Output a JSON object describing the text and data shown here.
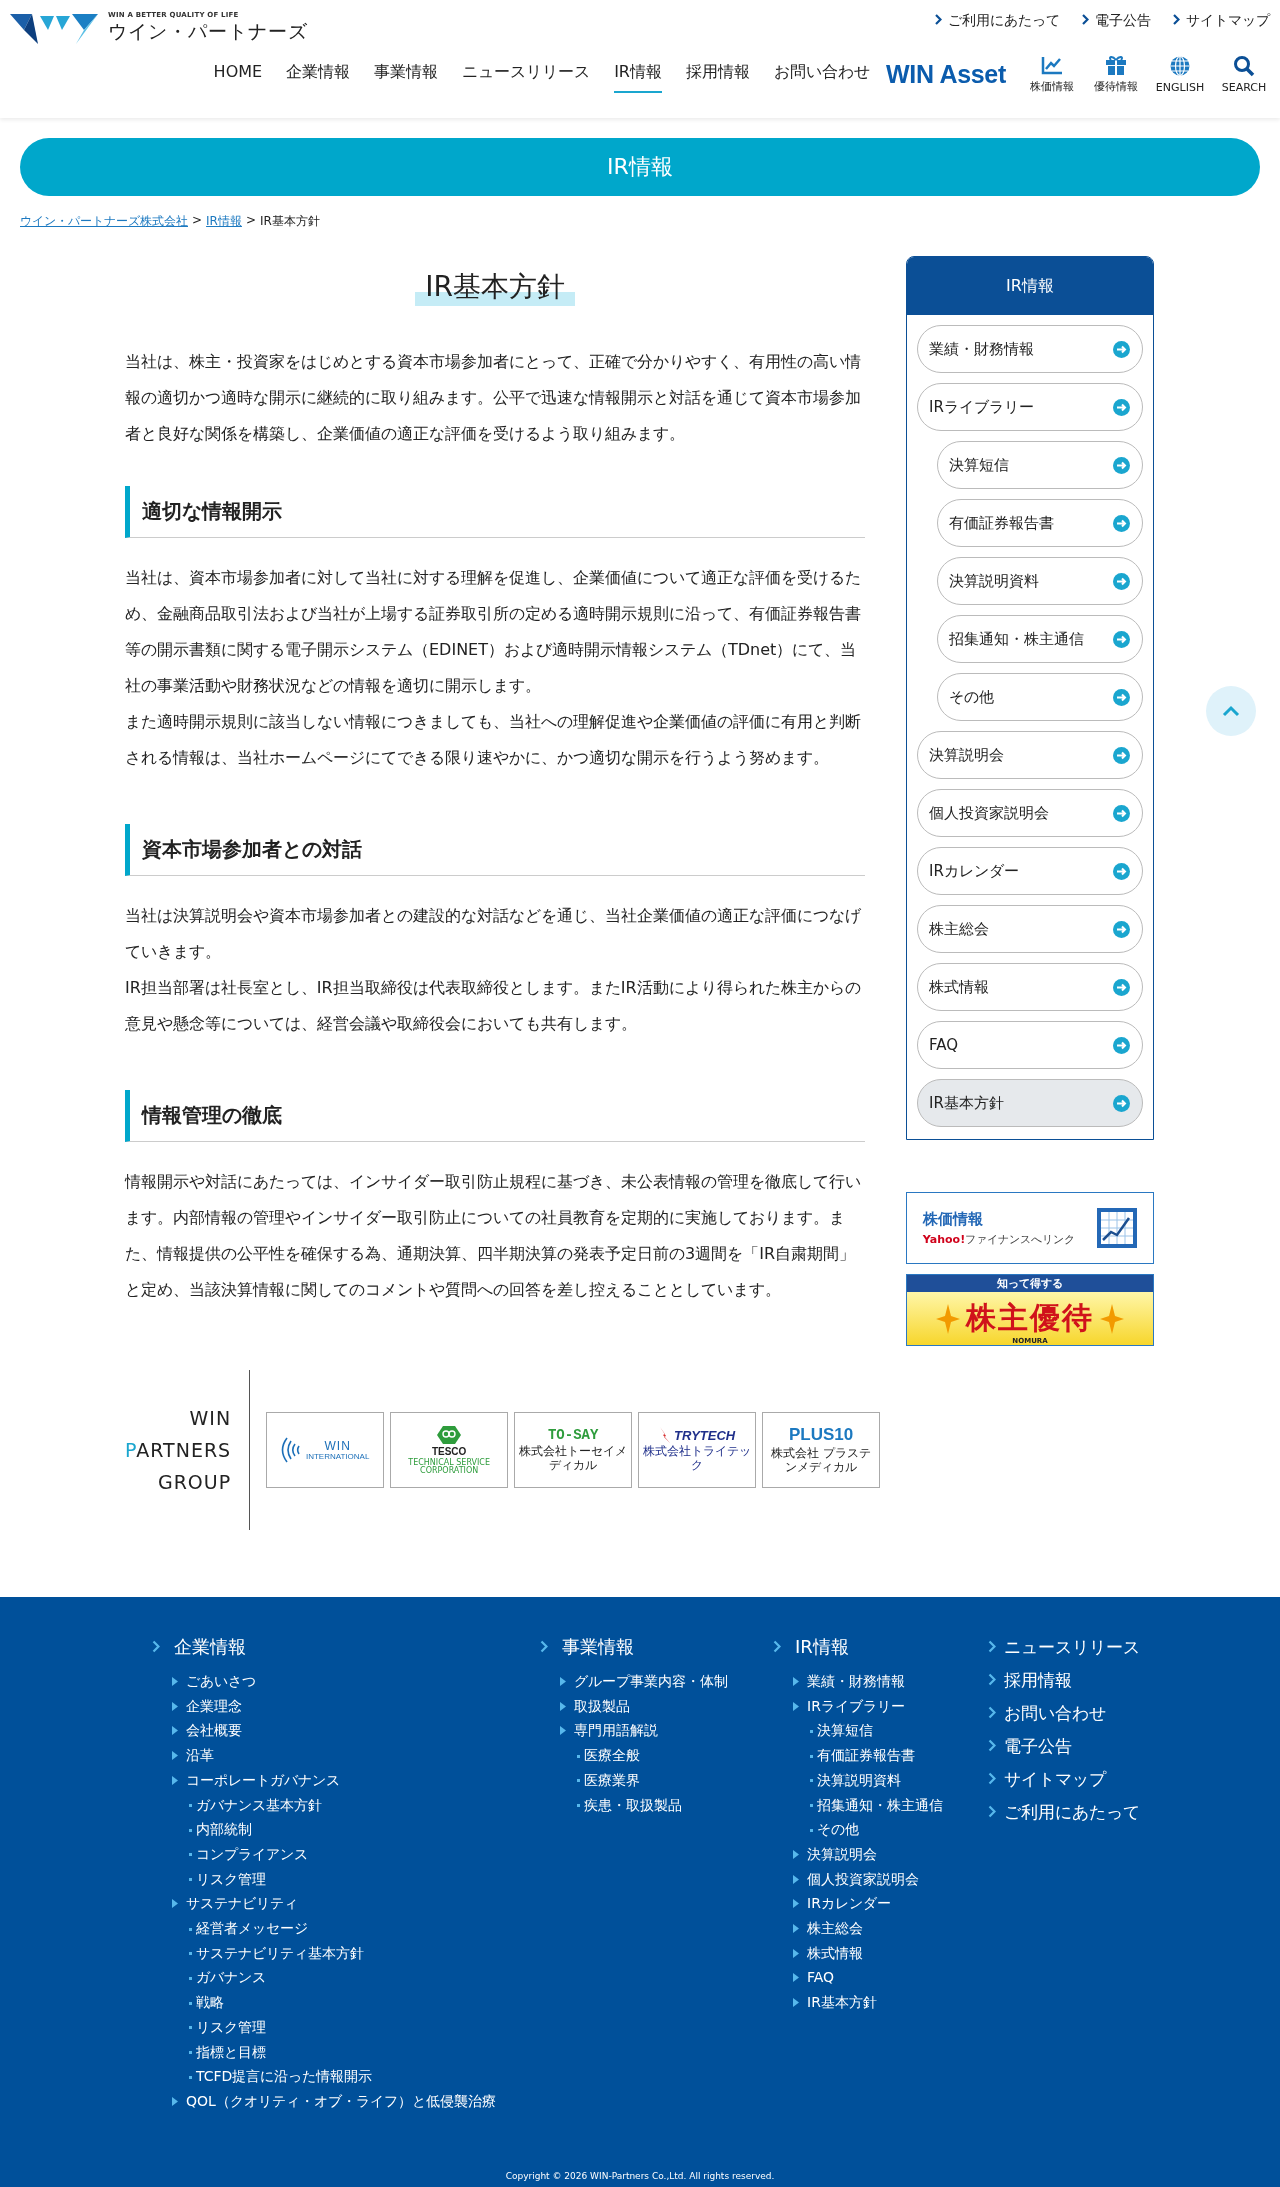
{
  "header": {
    "logo_tagline": "WIN A BETTER QUALITY OF LIFE",
    "logo_name": "ウイン・パートナーズ",
    "utility_links": [
      "ご利用にあたって",
      "電子公告",
      "サイトマップ"
    ],
    "nav": [
      {
        "label": "HOME",
        "selected": false
      },
      {
        "label": "企業情報",
        "selected": false
      },
      {
        "label": "事業情報",
        "selected": false
      },
      {
        "label": "ニュースリリース",
        "selected": false
      },
      {
        "label": "IR情報",
        "selected": true
      },
      {
        "label": "採用情報",
        "selected": false
      },
      {
        "label": "お問い合わせ",
        "selected": false
      }
    ],
    "brand_link": "WIN Asset",
    "icon_links": [
      {
        "kind": "chart",
        "label": "株価情報"
      },
      {
        "kind": "gift",
        "label": "優待情報"
      },
      {
        "kind": "globe",
        "label": "ENGLISH"
      },
      {
        "kind": "search",
        "label": "SEARCH"
      }
    ]
  },
  "banner": {
    "title": "IR情報"
  },
  "breadcrumb": [
    {
      "label": "ウイン・パートナーズ株式会社",
      "link": true
    },
    {
      "label": "IR情報",
      "link": true
    },
    {
      "label": "IR基本方針",
      "link": false
    }
  ],
  "breadcrumb_separator": ">",
  "page_title": "IR基本方針",
  "intro": "当社は、株主・投資家をはじめとする資本市場参加者にとって、正確で分かりやすく、有用性の高い情報の適切かつ適時な開示に継続的に取り組みます。公平で迅速な情報開示と対話を通じて資本市場参加者と良好な関係を構築し、企業価値の適正な評価を受けるよう取り組みます。",
  "sections": [
    {
      "heading": "適切な情報開示",
      "paragraphs": [
        "当社は、資本市場参加者に対して当社に対する理解を促進し、企業価値について適正な評価を受けるため、金融商品取引法および当社が上場する証券取引所の定める適時開示規則に沿って、有価証券報告書等の開示書類に関する電子開示システム（EDINET）および適時開示情報システム（TDnet）にて、当社の事業活動や財務状況などの情報を適切に開示します。",
        "また適時開示規則に該当しない情報につきましても、当社への理解促進や企業価値の評価に有用と判断される情報は、当社ホームページにてできる限り速やかに、かつ適切な開示を行うよう努めます。"
      ]
    },
    {
      "heading": "資本市場参加者との対話",
      "paragraphs": [
        "当社は決算説明会や資本市場参加者との建設的な対話などを通じ、当社企業価値の適正な評価につなげていきます。",
        "IR担当部署は社長室とし、IR担当取締役は代表取締役とします。またIR活動により得られた株主からの意見や懸念等については、経営会議や取締役会においても共有します。"
      ]
    },
    {
      "heading": "情報管理の徹底",
      "paragraphs": [
        "情報開示や対話にあたっては、インサイダー取引防止規程に基づき、未公表情報の管理を徹底して行います。内部情報の管理やインサイダー取引防止についての社員教育を定期的に実施しております。また、情報提供の公平性を確保する為、通期決算、四半期決算の発表予定日前の3週間を「IR自粛期間」と定め、当該決算情報に関してのコメントや質問への回答を差し控えることとしています。"
      ]
    }
  ],
  "partners": {
    "lines": [
      "WIN",
      "PARTNERS",
      "GROUP"
    ],
    "logos": [
      {
        "kind": "win",
        "name": "WIN",
        "sub": "INTERNATIONAL"
      },
      {
        "kind": "tesco",
        "name": "TESCO",
        "sub": "TECHNICAL SERVICE CORPORATION"
      },
      {
        "kind": "tosay",
        "name": "TO-SAY",
        "sub": "株式会社トーセイメディカル"
      },
      {
        "kind": "trytech",
        "name": "TRYTECH",
        "sub": "株式会社トライテック"
      },
      {
        "kind": "plus",
        "name": "PLUS10",
        "sub": "株式会社 プラステンメディカル"
      }
    ]
  },
  "sidebar": {
    "title": "IR情報",
    "items": [
      {
        "label": "業績・財務情報",
        "selected": false
      },
      {
        "label": "IRライブラリー",
        "selected": false,
        "children": [
          {
            "label": "決算短信",
            "selected": false
          },
          {
            "label": "有価証券報告書",
            "selected": false
          },
          {
            "label": "決算説明資料",
            "selected": false
          },
          {
            "label": "招集通知・株主通信",
            "selected": false
          },
          {
            "label": "その他",
            "selected": false
          }
        ]
      },
      {
        "label": "決算説明会",
        "selected": false
      },
      {
        "label": "個人投資家説明会",
        "selected": false
      },
      {
        "label": "IRカレンダー",
        "selected": false
      },
      {
        "label": "株主総会",
        "selected": false
      },
      {
        "label": "株式情報",
        "selected": false
      },
      {
        "label": "FAQ",
        "selected": false
      },
      {
        "label": "IR基本方針",
        "selected": true
      }
    ],
    "stock_banner": {
      "title": "株価情報",
      "yahoo": "Yahoo!",
      "text": "ファイナンスへリンク"
    },
    "benefit_banner": {
      "top": "知って得する",
      "title": "株主優待",
      "brand": "NOMURA"
    }
  },
  "footer": {
    "sections": [
      {
        "heading": "企業情報",
        "items": [
          {
            "label": "ごあいさつ"
          },
          {
            "label": "企業理念"
          },
          {
            "label": "会社概要"
          },
          {
            "label": "沿革"
          },
          {
            "label": "コーポレートガバナンス",
            "children": [
              {
                "label": "ガバナンス基本方針"
              },
              {
                "label": "内部統制"
              },
              {
                "label": "コンプライアンス"
              },
              {
                "label": "リスク管理"
              }
            ]
          },
          {
            "label": "サステナビリティ",
            "children": [
              {
                "label": "経営者メッセージ"
              },
              {
                "label": "サステナビリティ基本方針"
              },
              {
                "label": "ガバナンス"
              },
              {
                "label": "戦略"
              },
              {
                "label": "リスク管理"
              },
              {
                "label": "指標と目標"
              },
              {
                "label": "TCFD提言に沿った情報開示"
              }
            ]
          },
          {
            "label": "QOL（クオリティ・オブ・ライフ）と低侵襲治療"
          }
        ]
      },
      {
        "heading": "事業情報",
        "items": [
          {
            "label": "グループ事業内容・体制"
          },
          {
            "label": "取扱製品"
          },
          {
            "label": "専門用語解説",
            "children": [
              {
                "label": "医療全般"
              },
              {
                "label": "医療業界"
              },
              {
                "label": "疾患・取扱製品"
              }
            ]
          }
        ]
      },
      {
        "heading": "IR情報",
        "items": [
          {
            "label": "業績・財務情報"
          },
          {
            "label": "IRライブラリー",
            "children": [
              {
                "label": "決算短信"
              },
              {
                "label": "有価証券報告書"
              },
              {
                "label": "決算説明資料"
              },
              {
                "label": "招集通知・株主通信"
              },
              {
                "label": "その他"
              }
            ]
          },
          {
            "label": "決算説明会"
          },
          {
            "label": "個人投資家説明会"
          },
          {
            "label": "IRカレンダー"
          },
          {
            "label": "株主総会"
          },
          {
            "label": "株式情報"
          },
          {
            "label": "FAQ"
          },
          {
            "label": "IR基本方針"
          }
        ]
      }
    ],
    "links": [
      "ニュースリリース",
      "採用情報",
      "お問い合わせ",
      "電子公告",
      "サイトマップ",
      "ご利用にあたって"
    ],
    "copyright": "Copyright © 2026 WIN-Partners Co.,Ltd. All rights reserved."
  }
}
